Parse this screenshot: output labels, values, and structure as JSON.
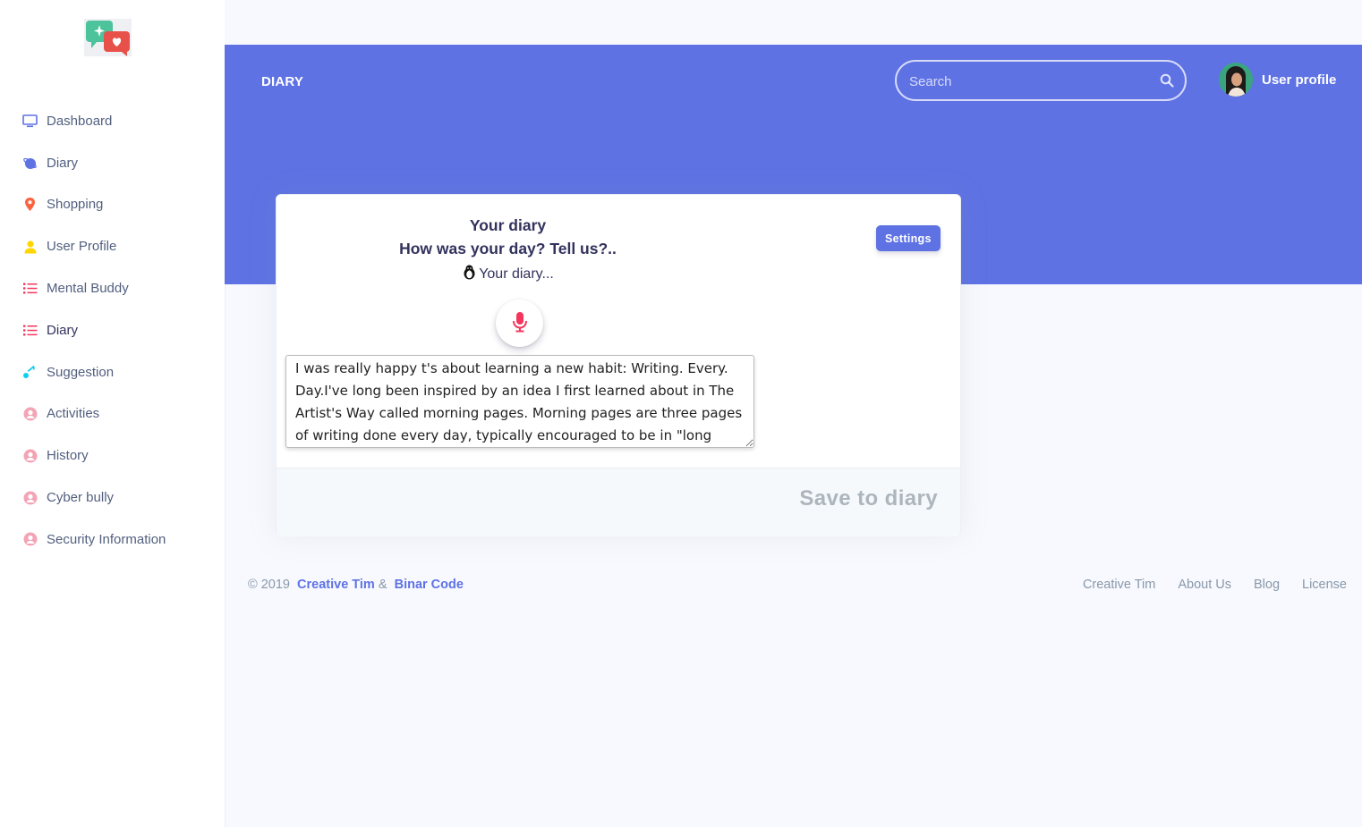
{
  "sidebar": {
    "items": [
      {
        "label": "Dashboard",
        "icon": "tv-icon",
        "color": "#5e72e4"
      },
      {
        "label": "Diary",
        "icon": "planet-icon",
        "color": "#5e72e4"
      },
      {
        "label": "Shopping",
        "icon": "pin-icon",
        "color": "#fb6340"
      },
      {
        "label": "User Profile",
        "icon": "user-icon",
        "color": "#ffd600"
      },
      {
        "label": "Mental Buddy",
        "icon": "bullet-list-icon",
        "color": "#f5365c"
      },
      {
        "label": "Diary",
        "icon": "bullet-list-icon",
        "color": "#f5365c"
      },
      {
        "label": "Suggestion",
        "icon": "key-icon",
        "color": "#11cdef"
      },
      {
        "label": "Activities",
        "icon": "circle-user-icon",
        "color": "#f3a4b5"
      },
      {
        "label": "History",
        "icon": "circle-user-icon",
        "color": "#f3a4b5"
      },
      {
        "label": "Cyber bully",
        "icon": "circle-user-icon",
        "color": "#f3a4b5"
      },
      {
        "label": "Security Information",
        "icon": "circle-user-icon",
        "color": "#f3a4b5"
      }
    ]
  },
  "header": {
    "brand": "DIARY",
    "search_placeholder": "Search",
    "profile_name": "User profile",
    "background": "#5e72e4"
  },
  "card": {
    "title": "Your diary",
    "subtitle": "How was your day? Tell us?..",
    "tagline": "Your diary...",
    "settings_label": "Settings",
    "diary_text": "I was really happy t's about learning a new habit: Writing. Every. Day.I've long been inspired by an idea I first learned about in The Artist's Way called morning pages. Morning pages are three pages of writing done every day, typically encouraged to be in \"long",
    "save_label": "Save to diary"
  },
  "footer": {
    "copyright": "© 2019",
    "link1": "Creative Tim",
    "amp": "&",
    "link2": "Binar Code",
    "links": [
      "Creative Tim",
      "About Us",
      "Blog",
      "License"
    ]
  }
}
